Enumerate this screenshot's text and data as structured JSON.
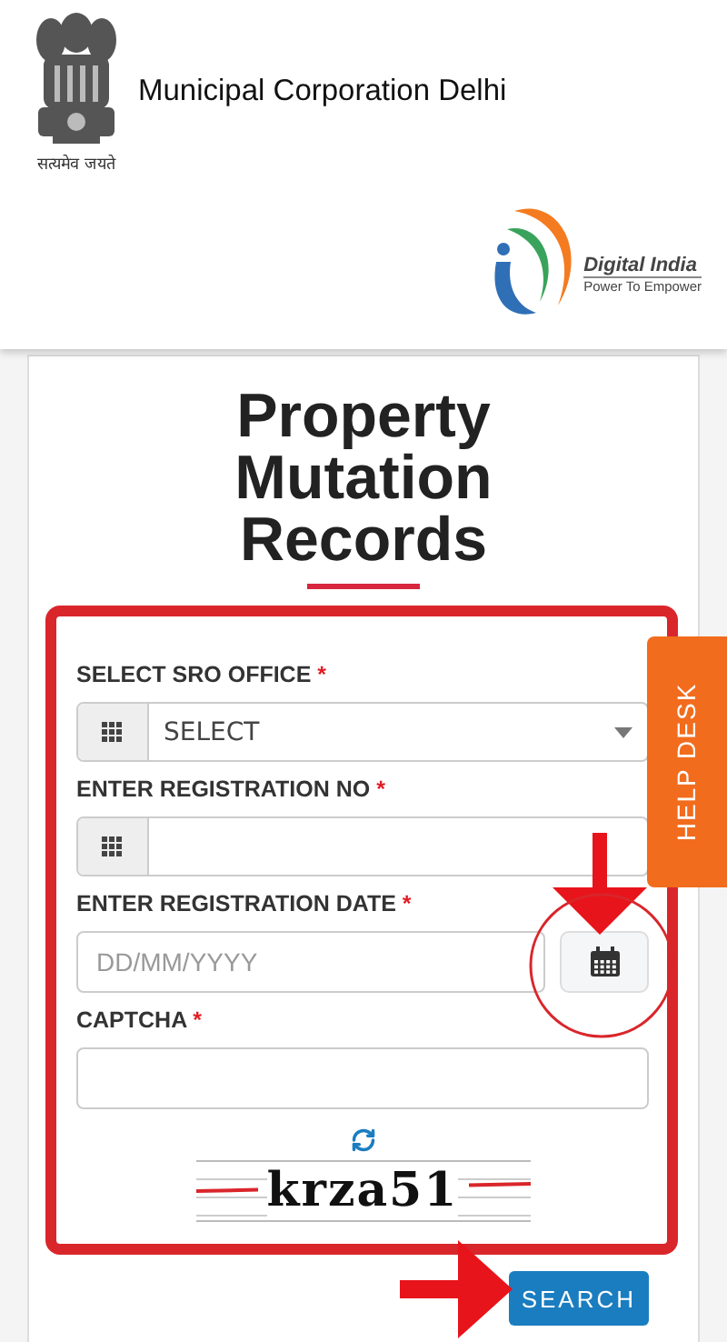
{
  "header": {
    "title": "Municipal Corporation Delhi",
    "emblem_motto": "सत्यमेव जयते",
    "logo_title": "Digital India",
    "logo_tagline": "Power To Empower"
  },
  "page_title": "Property Mutation Records",
  "fields": [
    {
      "kind": "select",
      "label": "SELECT SRO OFFICE",
      "required_mark": "*",
      "value": "SELECT"
    },
    {
      "kind": "grid-input",
      "label": "ENTER REGISTRATION NO",
      "required_mark": "*"
    },
    {
      "kind": "date",
      "label": "ENTER REGISTRATION DATE",
      "required_mark": "*",
      "placeholder": "DD/MM/YYYY"
    },
    {
      "kind": "text",
      "label": "CAPTCHA",
      "required_mark": "*"
    }
  ],
  "captcha": {
    "text": "krza51"
  },
  "search_button": "SEARCH",
  "help_desk": "HELP DESK"
}
